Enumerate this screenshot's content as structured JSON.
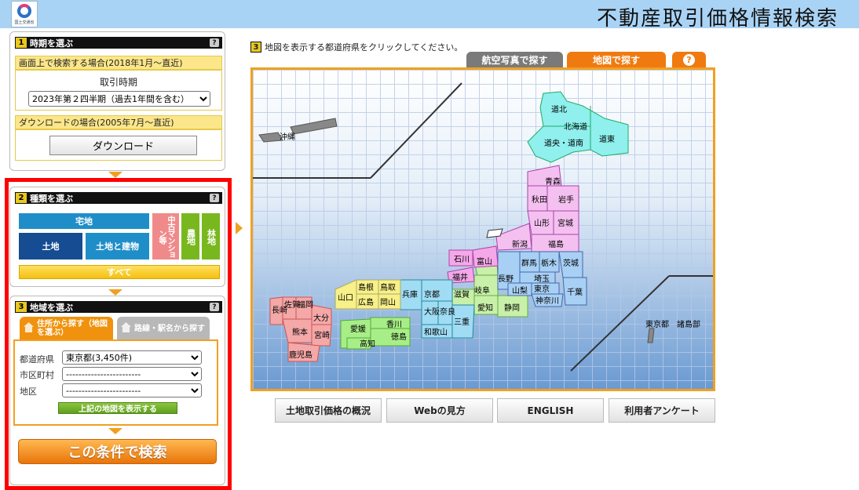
{
  "header": {
    "title": "不動産取引価格情報検索",
    "logo_text": "国土交通省"
  },
  "panel1": {
    "num": "1",
    "title": "時期を選ぶ",
    "help": "?",
    "screen_label": "画面上で検索する場合(2018年1月～直近)",
    "period_label": "取引時期",
    "period_value": "2023年第２四半期（過去1年間を含む）",
    "download_label": "ダウンロードの場合(2005年7月～直近)",
    "download_button": "ダウンロード"
  },
  "panel2": {
    "num": "2",
    "title": "種類を選ぶ",
    "help": "?",
    "takuchi": "宅地",
    "tochi": "土地",
    "tochi_tatemono": "土地と建物",
    "chuko": "中古マンション等",
    "nouchi": "農地",
    "rinchi": "林地",
    "all": "すべて"
  },
  "panel3": {
    "num": "3",
    "title": "地域を選ぶ",
    "help": "?",
    "tab_address": "住所から探す（地図を選ぶ）",
    "tab_route": "路線・駅名から探す",
    "pref_label": "都道府県",
    "pref_value": "東京都(3,450件)",
    "city_label": "市区町村",
    "city_value": "------------------------",
    "district_label": "地区",
    "district_value": "------------------------",
    "show_map_button": "上記の地図を表示する",
    "search_button": "この条件で検索"
  },
  "map": {
    "num": "3",
    "instruction": "地図を表示する都道府県をクリックしてください。",
    "tab_aerial": "航空写真で探す",
    "tab_map": "地図で探す",
    "tab_help": "?",
    "colors": {
      "hokkaido": "#8ff0ee",
      "tohoku": "#f4c0f0",
      "kanto": "#a8d0f4",
      "chubu": "#c8f0a8",
      "kinki": "#a0dcf4",
      "chugoku": "#f8f088",
      "shikoku": "#a8ee88",
      "kyushu": "#f4a8a8",
      "okinawa": "#888888"
    },
    "labels": {
      "dohoku": "道北",
      "hokkaido": "北海道",
      "dooh": "道央・道南",
      "doto": "道東",
      "aomori": "青森",
      "akita": "秋田",
      "iwate": "岩手",
      "yamagata": "山形",
      "miyagi": "宮城",
      "fukushima": "福島",
      "niigata": "新潟",
      "ishikawa": "石川",
      "toyama": "富山",
      "fukui": "福井",
      "nagano": "長野",
      "gunma": "群馬",
      "tochigi": "栃木",
      "ibaraki": "茨城",
      "saitama": "埼玉",
      "yamanashi": "山梨",
      "tokyo": "東京",
      "chiba": "千葉",
      "kanagawa": "神奈川",
      "gifu": "岐阜",
      "shiga": "滋賀",
      "kyoto": "京都",
      "hyogo": "兵庫",
      "osaka": "大阪",
      "nara": "奈良",
      "mie": "三重",
      "aichi": "愛知",
      "shizuoka": "静岡",
      "wakayama": "和歌山",
      "shimane": "島根",
      "tottori": "鳥取",
      "yamaguchi": "山口",
      "hiroshima": "広島",
      "okayama": "岡山",
      "ehime": "愛媛",
      "kagawa": "香川",
      "kochi": "高知",
      "tokushima": "徳島",
      "fukuoka": "福岡",
      "saga": "佐賀",
      "nagasaki": "長崎",
      "oita": "大分",
      "kumamoto": "熊本",
      "miyazaki": "宮崎",
      "kagoshima": "鹿児島",
      "okinawa": "沖縄",
      "islands": "東京都　諸島部"
    }
  },
  "footer_buttons": [
    "土地取引価格の概況",
    "Webの見方",
    "ENGLISH",
    "利用者アンケート"
  ]
}
